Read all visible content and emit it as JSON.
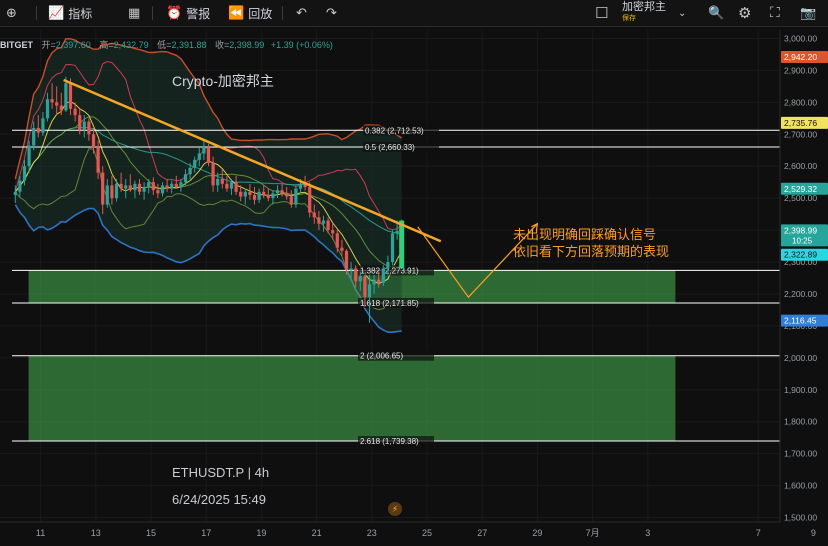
{
  "toolbar": {
    "indicators_label": "指标",
    "alert_label": "警报",
    "replay_label": "回放",
    "account_name": "加密邦主",
    "account_tag": "保存"
  },
  "legend": {
    "symbol": "BITGET",
    "open_label": "开=",
    "open": "2,397.60",
    "high_label": "高=",
    "high": "2,432.79",
    "low_label": "低=",
    "low": "2,391.88",
    "close_label": "收=",
    "close": "2,398.99",
    "change": "+1.39 (+0.06%)"
  },
  "watermark": {
    "brand": "Crypto-加密邦主",
    "ticker": "ETHUSDT.P | 4h",
    "datetime": "6/24/2025 15:49"
  },
  "annotation": {
    "line1": "未出现明确回踩确认信号",
    "line2": "依旧看下方回落预期的表现"
  },
  "colors": {
    "up": "#26a69a",
    "down": "#ef5350",
    "trendline": "#f5a623",
    "fib_line": "#ffffff",
    "zone": "#3fa14a",
    "annotation": "#ff9f1c"
  },
  "chart_data": {
    "type": "candlestick",
    "timeframe": "4h",
    "ylim": [
      1500,
      3000
    ],
    "xlim": [
      "2025-06-10",
      "2025-07-09"
    ],
    "y_ticks": [
      "3,000.00",
      "2,900.00",
      "2,800.00",
      "2,700.00",
      "2,600.00",
      "2,500.00",
      "2,400.00",
      "2,300.00",
      "2,200.00",
      "2,100.00",
      "2,000.00",
      "1,900.00",
      "1,800.00",
      "1,700.00",
      "1,600.00",
      "1,500.00"
    ],
    "x_ticks": [
      {
        "label": "11",
        "date": "2025-06-11"
      },
      {
        "label": "13",
        "date": "2025-06-13"
      },
      {
        "label": "15",
        "date": "2025-06-15"
      },
      {
        "label": "17",
        "date": "2025-06-17"
      },
      {
        "label": "19",
        "date": "2025-06-19"
      },
      {
        "label": "21",
        "date": "2025-06-21"
      },
      {
        "label": "23",
        "date": "2025-06-23"
      },
      {
        "label": "25",
        "date": "2025-06-25"
      },
      {
        "label": "27",
        "date": "2025-06-27"
      },
      {
        "label": "29",
        "date": "2025-06-29"
      },
      {
        "label": "7月",
        "date": "2025-07-01"
      },
      {
        "label": "3",
        "date": "2025-07-03"
      },
      {
        "label": "7",
        "date": "2025-07-07"
      },
      {
        "label": "9",
        "date": "2025-07-09"
      }
    ],
    "fib_levels": [
      {
        "ratio": "0.382",
        "label": "0.382 (2,712.53)",
        "value": 2712.53
      },
      {
        "ratio": "0.5",
        "label": "0.5 (2,660.33)",
        "value": 2660.33
      },
      {
        "ratio": "1.382",
        "label": "1.382 (2,273.91)",
        "value": 2273.91
      },
      {
        "ratio": "1.618",
        "label": "1.618 (2,171.85)",
        "value": 2171.85
      },
      {
        "ratio": "2",
        "label": "2 (2,006.65)",
        "value": 2006.65
      },
      {
        "ratio": "2.618",
        "label": "2.618 (1,739.38)",
        "value": 1739.38
      }
    ],
    "price_tags": [
      {
        "label": "2,942.20",
        "value": 2942.2,
        "color": "#e0542a"
      },
      {
        "label": "2,735.76",
        "value": 2735.76,
        "color": "#f2e25c"
      },
      {
        "label": "2,529.32",
        "value": 2529.32,
        "color": "#26a69a"
      },
      {
        "label": "2,398.99",
        "value": 2398.99,
        "color": "#26a69a",
        "sub": "10:25"
      },
      {
        "label": "2,322.89",
        "value": 2322.89,
        "color": "#2ad6e0"
      },
      {
        "label": "2,116.45",
        "value": 2116.45,
        "color": "#2e7fd8"
      }
    ],
    "zones": [
      {
        "from": 2171.85,
        "to": 2273.91,
        "start": "2025-06-11",
        "end": "2025-07-04"
      },
      {
        "from": 1739.38,
        "to": 2006.65,
        "start": "2025-06-11",
        "end": "2025-07-04"
      }
    ],
    "trendline": {
      "from": {
        "date": "2025-06-11T20:00",
        "value": 2870
      },
      "to": {
        "date": "2025-06-25T12:00",
        "value": 2365
      }
    },
    "projection": [
      {
        "date": "2025-06-24T16:00",
        "value": 2410
      },
      {
        "date": "2025-06-26T12:00",
        "value": 2190
      },
      {
        "date": "2025-06-29T00:00",
        "value": 2420
      }
    ],
    "candles": [
      {
        "t": "06-10 00",
        "o": 2510,
        "h": 2540,
        "l": 2485,
        "c": 2520
      },
      {
        "t": "06-10 04",
        "o": 2520,
        "h": 2570,
        "l": 2505,
        "c": 2555
      },
      {
        "t": "06-10 08",
        "o": 2555,
        "h": 2620,
        "l": 2540,
        "c": 2600
      },
      {
        "t": "06-10 12",
        "o": 2600,
        "h": 2680,
        "l": 2580,
        "c": 2665
      },
      {
        "t": "06-10 16",
        "o": 2665,
        "h": 2740,
        "l": 2650,
        "c": 2720
      },
      {
        "t": "06-10 20",
        "o": 2720,
        "h": 2760,
        "l": 2690,
        "c": 2705
      },
      {
        "t": "06-11 00",
        "o": 2705,
        "h": 2770,
        "l": 2695,
        "c": 2750
      },
      {
        "t": "06-11 04",
        "o": 2750,
        "h": 2830,
        "l": 2740,
        "c": 2810
      },
      {
        "t": "06-11 08",
        "o": 2810,
        "h": 2860,
        "l": 2780,
        "c": 2800
      },
      {
        "t": "06-11 12",
        "o": 2800,
        "h": 2850,
        "l": 2760,
        "c": 2790
      },
      {
        "t": "06-11 16",
        "o": 2790,
        "h": 2830,
        "l": 2760,
        "c": 2775
      },
      {
        "t": "06-11 20",
        "o": 2775,
        "h": 2880,
        "l": 2770,
        "c": 2860
      },
      {
        "t": "06-12 00",
        "o": 2860,
        "h": 2875,
        "l": 2760,
        "c": 2780
      },
      {
        "t": "06-12 04",
        "o": 2780,
        "h": 2800,
        "l": 2740,
        "c": 2760
      },
      {
        "t": "06-12 08",
        "o": 2760,
        "h": 2780,
        "l": 2700,
        "c": 2715
      },
      {
        "t": "06-12 12",
        "o": 2715,
        "h": 2760,
        "l": 2690,
        "c": 2740
      },
      {
        "t": "06-12 16",
        "o": 2740,
        "h": 2750,
        "l": 2680,
        "c": 2700
      },
      {
        "t": "06-12 20",
        "o": 2700,
        "h": 2720,
        "l": 2640,
        "c": 2660
      },
      {
        "t": "06-13 00",
        "o": 2660,
        "h": 2680,
        "l": 2560,
        "c": 2580
      },
      {
        "t": "06-13 04",
        "o": 2580,
        "h": 2600,
        "l": 2450,
        "c": 2480
      },
      {
        "t": "06-13 08",
        "o": 2480,
        "h": 2560,
        "l": 2470,
        "c": 2540
      },
      {
        "t": "06-13 12",
        "o": 2540,
        "h": 2570,
        "l": 2480,
        "c": 2500
      },
      {
        "t": "06-13 16",
        "o": 2500,
        "h": 2560,
        "l": 2490,
        "c": 2545
      },
      {
        "t": "06-13 20",
        "o": 2545,
        "h": 2580,
        "l": 2520,
        "c": 2530
      },
      {
        "t": "06-14 00",
        "o": 2530,
        "h": 2560,
        "l": 2500,
        "c": 2540
      },
      {
        "t": "06-14 04",
        "o": 2540,
        "h": 2575,
        "l": 2520,
        "c": 2525
      },
      {
        "t": "06-14 08",
        "o": 2525,
        "h": 2555,
        "l": 2500,
        "c": 2545
      },
      {
        "t": "06-14 12",
        "o": 2545,
        "h": 2560,
        "l": 2510,
        "c": 2520
      },
      {
        "t": "06-14 16",
        "o": 2520,
        "h": 2550,
        "l": 2495,
        "c": 2535
      },
      {
        "t": "06-14 20",
        "o": 2535,
        "h": 2560,
        "l": 2515,
        "c": 2550
      },
      {
        "t": "06-15 00",
        "o": 2550,
        "h": 2565,
        "l": 2510,
        "c": 2525
      },
      {
        "t": "06-15 04",
        "o": 2525,
        "h": 2545,
        "l": 2500,
        "c": 2515
      },
      {
        "t": "06-15 08",
        "o": 2515,
        "h": 2550,
        "l": 2505,
        "c": 2540
      },
      {
        "t": "06-15 12",
        "o": 2540,
        "h": 2560,
        "l": 2520,
        "c": 2530
      },
      {
        "t": "06-15 16",
        "o": 2530,
        "h": 2555,
        "l": 2515,
        "c": 2545
      },
      {
        "t": "06-15 20",
        "o": 2545,
        "h": 2570,
        "l": 2530,
        "c": 2535
      },
      {
        "t": "06-16 00",
        "o": 2535,
        "h": 2560,
        "l": 2520,
        "c": 2550
      },
      {
        "t": "06-16 04",
        "o": 2550,
        "h": 2590,
        "l": 2540,
        "c": 2575
      },
      {
        "t": "06-16 08",
        "o": 2575,
        "h": 2610,
        "l": 2560,
        "c": 2595
      },
      {
        "t": "06-16 12",
        "o": 2595,
        "h": 2630,
        "l": 2580,
        "c": 2620
      },
      {
        "t": "06-16 16",
        "o": 2620,
        "h": 2660,
        "l": 2600,
        "c": 2640
      },
      {
        "t": "06-16 20",
        "o": 2640,
        "h": 2680,
        "l": 2620,
        "c": 2660
      },
      {
        "t": "06-17 00",
        "o": 2660,
        "h": 2670,
        "l": 2600,
        "c": 2610
      },
      {
        "t": "06-17 04",
        "o": 2610,
        "h": 2630,
        "l": 2520,
        "c": 2540
      },
      {
        "t": "06-17 08",
        "o": 2540,
        "h": 2580,
        "l": 2520,
        "c": 2560
      },
      {
        "t": "06-17 12",
        "o": 2560,
        "h": 2590,
        "l": 2530,
        "c": 2545
      },
      {
        "t": "06-17 16",
        "o": 2545,
        "h": 2570,
        "l": 2520,
        "c": 2530
      },
      {
        "t": "06-17 20",
        "o": 2530,
        "h": 2560,
        "l": 2510,
        "c": 2550
      },
      {
        "t": "06-18 00",
        "o": 2550,
        "h": 2570,
        "l": 2510,
        "c": 2520
      },
      {
        "t": "06-18 04",
        "o": 2520,
        "h": 2540,
        "l": 2490,
        "c": 2505
      },
      {
        "t": "06-18 08",
        "o": 2505,
        "h": 2530,
        "l": 2480,
        "c": 2520
      },
      {
        "t": "06-18 12",
        "o": 2520,
        "h": 2545,
        "l": 2495,
        "c": 2510
      },
      {
        "t": "06-18 16",
        "o": 2510,
        "h": 2535,
        "l": 2480,
        "c": 2495
      },
      {
        "t": "06-18 20",
        "o": 2495,
        "h": 2530,
        "l": 2485,
        "c": 2520
      },
      {
        "t": "06-19 00",
        "o": 2520,
        "h": 2540,
        "l": 2500,
        "c": 2510
      },
      {
        "t": "06-19 04",
        "o": 2510,
        "h": 2530,
        "l": 2490,
        "c": 2500
      },
      {
        "t": "06-19 08",
        "o": 2500,
        "h": 2525,
        "l": 2480,
        "c": 2515
      },
      {
        "t": "06-19 12",
        "o": 2515,
        "h": 2540,
        "l": 2500,
        "c": 2525
      },
      {
        "t": "06-19 16",
        "o": 2525,
        "h": 2545,
        "l": 2505,
        "c": 2515
      },
      {
        "t": "06-19 20",
        "o": 2515,
        "h": 2535,
        "l": 2495,
        "c": 2505
      },
      {
        "t": "06-20 00",
        "o": 2505,
        "h": 2525,
        "l": 2470,
        "c": 2480
      },
      {
        "t": "06-20 04",
        "o": 2480,
        "h": 2540,
        "l": 2470,
        "c": 2530
      },
      {
        "t": "06-20 08",
        "o": 2530,
        "h": 2560,
        "l": 2515,
        "c": 2545
      },
      {
        "t": "06-20 12",
        "o": 2545,
        "h": 2570,
        "l": 2525,
        "c": 2535
      },
      {
        "t": "06-20 16",
        "o": 2535,
        "h": 2550,
        "l": 2440,
        "c": 2455
      },
      {
        "t": "06-20 20",
        "o": 2455,
        "h": 2480,
        "l": 2420,
        "c": 2440
      },
      {
        "t": "06-21 00",
        "o": 2440,
        "h": 2460,
        "l": 2400,
        "c": 2420
      },
      {
        "t": "06-21 04",
        "o": 2420,
        "h": 2445,
        "l": 2395,
        "c": 2430
      },
      {
        "t": "06-21 08",
        "o": 2430,
        "h": 2440,
        "l": 2390,
        "c": 2400
      },
      {
        "t": "06-21 12",
        "o": 2400,
        "h": 2420,
        "l": 2370,
        "c": 2390
      },
      {
        "t": "06-21 16",
        "o": 2390,
        "h": 2400,
        "l": 2330,
        "c": 2345
      },
      {
        "t": "06-21 20",
        "o": 2345,
        "h": 2370,
        "l": 2320,
        "c": 2335
      },
      {
        "t": "06-22 00",
        "o": 2335,
        "h": 2340,
        "l": 2260,
        "c": 2275
      },
      {
        "t": "06-22 04",
        "o": 2275,
        "h": 2300,
        "l": 2250,
        "c": 2280
      },
      {
        "t": "06-22 08",
        "o": 2280,
        "h": 2290,
        "l": 2220,
        "c": 2240
      },
      {
        "t": "06-22 12",
        "o": 2240,
        "h": 2270,
        "l": 2210,
        "c": 2255
      },
      {
        "t": "06-22 16",
        "o": 2255,
        "h": 2260,
        "l": 2160,
        "c": 2190
      },
      {
        "t": "06-22 20",
        "o": 2190,
        "h": 2260,
        "l": 2110,
        "c": 2230
      },
      {
        "t": "06-23 00",
        "o": 2230,
        "h": 2260,
        "l": 2200,
        "c": 2245
      },
      {
        "t": "06-23 04",
        "o": 2245,
        "h": 2270,
        "l": 2220,
        "c": 2235
      },
      {
        "t": "06-23 08",
        "o": 2235,
        "h": 2290,
        "l": 2225,
        "c": 2280
      },
      {
        "t": "06-23 12",
        "o": 2280,
        "h": 2320,
        "l": 2260,
        "c": 2300
      },
      {
        "t": "06-23 16",
        "o": 2300,
        "h": 2400,
        "l": 2290,
        "c": 2390
      },
      {
        "t": "06-23 20",
        "o": 2390,
        "h": 2430,
        "l": 2370,
        "c": 2397.6
      },
      {
        "t": "06-24 00",
        "o": 2397.6,
        "h": 2432.79,
        "l": 2391.88,
        "c": 2398.99
      }
    ]
  }
}
